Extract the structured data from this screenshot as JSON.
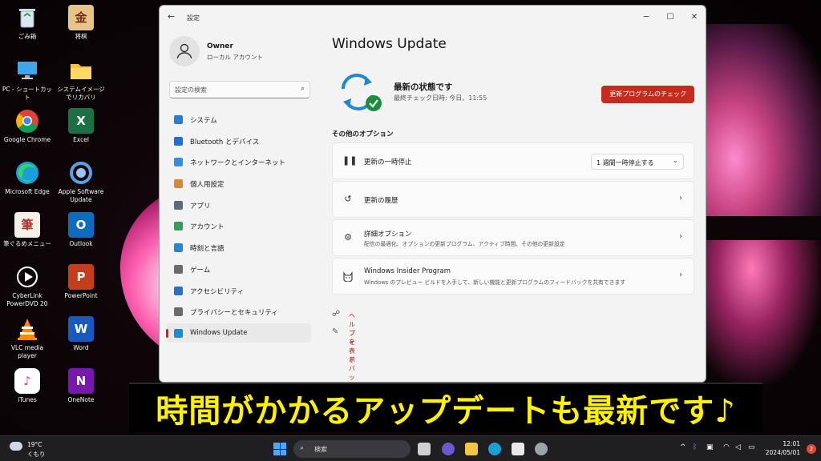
{
  "desktop": {
    "icons": [
      {
        "label": "ごみ箱",
        "icon": "recycle-bin-icon"
      },
      {
        "label": "将棋",
        "icon": "shogi-icon"
      },
      {
        "label": "PC - ショートカット",
        "icon": "pc-icon"
      },
      {
        "label": "システムイメージでリカバリ",
        "icon": "folder-icon"
      },
      {
        "label": "Google Chrome",
        "icon": "chrome-icon"
      },
      {
        "label": "Excel",
        "icon": "excel-icon"
      },
      {
        "label": "Microsoft Edge",
        "icon": "edge-icon"
      },
      {
        "label": "Apple Software Update",
        "icon": "apple-update-icon"
      },
      {
        "label": "筆ぐるめメニュー",
        "icon": "fudegurume-icon"
      },
      {
        "label": "Outlook",
        "icon": "outlook-icon"
      },
      {
        "label": "CyberLink PowerDVD 20",
        "icon": "powerdvd-icon"
      },
      {
        "label": "PowerPoint",
        "icon": "powerpoint-icon"
      },
      {
        "label": "VLC media player",
        "icon": "vlc-icon"
      },
      {
        "label": "Word",
        "icon": "word-icon"
      },
      {
        "label": "iTunes",
        "icon": "itunes-icon"
      },
      {
        "label": "OneNote",
        "icon": "onenote-icon"
      }
    ]
  },
  "window": {
    "title": "設定",
    "back": "←",
    "minimize": "─",
    "maximize": "☐",
    "close": "✕"
  },
  "profile": {
    "name": "Owner",
    "account_type": "ローカル アカウント"
  },
  "search": {
    "placeholder": "設定の検索"
  },
  "nav": {
    "items": [
      {
        "label": "システム",
        "icon": "system-icon",
        "color": "#2b7cd3"
      },
      {
        "label": "Bluetooth とデバイス",
        "icon": "bluetooth-icon",
        "color": "#1e6fd9"
      },
      {
        "label": "ネットワークとインターネット",
        "icon": "network-icon",
        "color": "#2f8fe0"
      },
      {
        "label": "個人用設定",
        "icon": "personalization-icon",
        "color": "#d6893a"
      },
      {
        "label": "アプリ",
        "icon": "apps-icon",
        "color": "#5b6b7d"
      },
      {
        "label": "アカウント",
        "icon": "account-icon",
        "color": "#2ea05a"
      },
      {
        "label": "時刻と言語",
        "icon": "time-language-icon",
        "color": "#2a86d1"
      },
      {
        "label": "ゲーム",
        "icon": "gaming-icon",
        "color": "#6b6b6b"
      },
      {
        "label": "アクセシビリティ",
        "icon": "accessibility-icon",
        "color": "#2a6fc9"
      },
      {
        "label": "プライバシーとセキュリティ",
        "icon": "privacy-icon",
        "color": "#6b6b6b"
      },
      {
        "label": "Windows Update",
        "icon": "windows-update-icon",
        "color": "#1e88d2"
      }
    ],
    "active_index": 10
  },
  "main": {
    "title": "Windows Update",
    "status_title": "最新の状態です",
    "status_sub": "最終チェック日時: 今日、11:55",
    "check_button": "更新プログラムのチェック",
    "section_label": "その他のオプション",
    "options": [
      {
        "title": "更新の一時停止",
        "desc": "",
        "icon": "pause-icon",
        "dropdown": "1 週間一時停止する"
      },
      {
        "title": "更新の履歴",
        "desc": "",
        "icon": "history-icon"
      },
      {
        "title": "詳細オプション",
        "desc": "配信の最適化、オプションの更新プログラム、アクティブ時間、その他の更新設定",
        "icon": "gears-icon"
      },
      {
        "title": "Windows Insider Program",
        "desc": "Windows のプレビュー ビルドを入手して、新しい機能と更新プログラムのフィードバックを共有できます",
        "icon": "insider-cat-icon"
      }
    ],
    "links": [
      {
        "label": "ヘルプを表示",
        "icon": "help-icon"
      },
      {
        "label": "フィードバックの送信",
        "icon": "feedback-icon"
      }
    ]
  },
  "banner": {
    "text": "時間がかかるアップデートも最新です♪"
  },
  "taskbar": {
    "weather_temp": "19°C",
    "weather_desc": "くもり",
    "search_label": "検索",
    "time": "12:01",
    "date": "2024/05/01",
    "notifications": "2"
  },
  "colors": {
    "accent": "#c42b1c",
    "link": "#b0271a",
    "banner_text": "#fff200"
  }
}
